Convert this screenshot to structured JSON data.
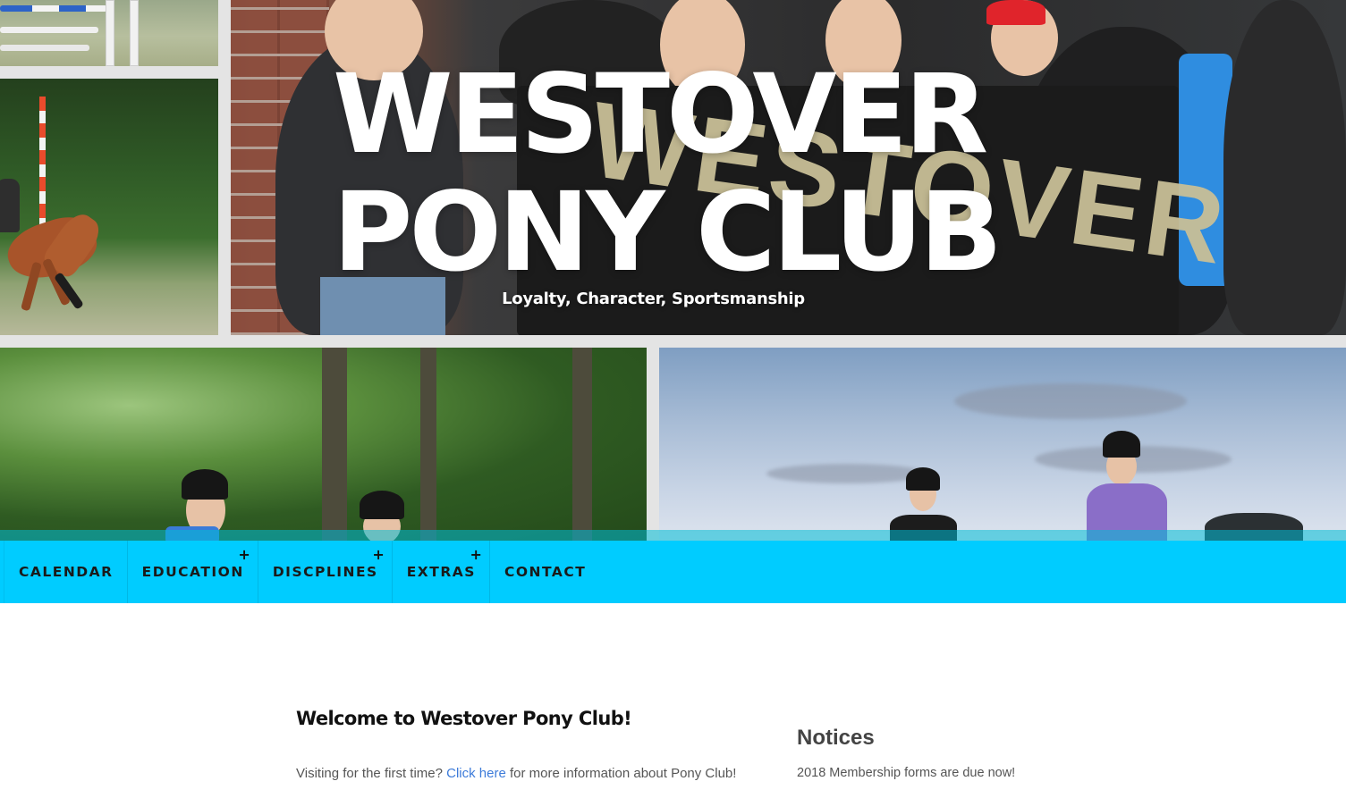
{
  "site": {
    "title_line1": "WESTOVER",
    "title_line2": "PONY CLUB",
    "tagline": "Loyalty, Character, Sportsmanship"
  },
  "hero": {
    "banner_text": "WESTOVER",
    "photos": [
      "jump-poles-photo",
      "horse-jumping-photo",
      "team-banner-photo",
      "riders-in-trees-photo",
      "riders-sky-photo"
    ]
  },
  "nav": {
    "color": "#00ccff",
    "items": [
      {
        "label": "CALENDAR",
        "has_submenu": false
      },
      {
        "label": "EDUCATION",
        "has_submenu": true
      },
      {
        "label": "DISCPLINES",
        "has_submenu": true
      },
      {
        "label": "EXTRAS",
        "has_submenu": true
      },
      {
        "label": "CONTACT",
        "has_submenu": false
      }
    ],
    "submenu_glyph": "+"
  },
  "main": {
    "welcome_title": "Welcome to Westover Pony Club!",
    "welcome_prefix": "Visiting for the first time? ",
    "welcome_link": "Click here",
    "welcome_suffix": " for more information about Pony Club!",
    "link_color": "#3d7bd9"
  },
  "sidebar": {
    "notices_title": "Notices",
    "notices_text": "2018 Membership forms are due now!"
  }
}
